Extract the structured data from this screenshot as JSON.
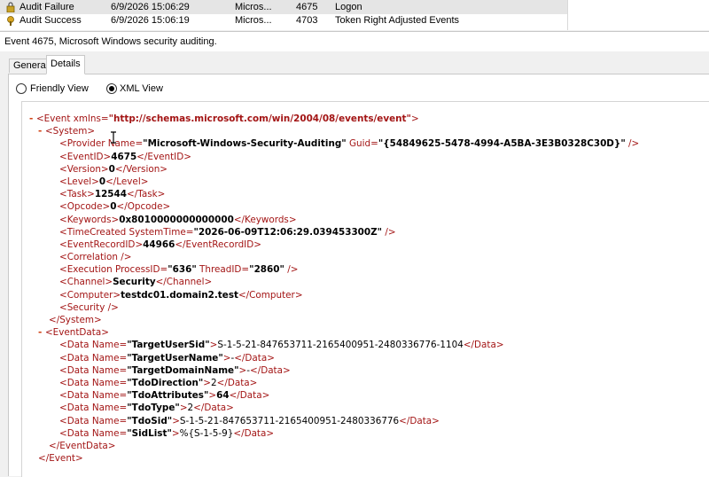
{
  "event_list": {
    "rows": [
      {
        "keywords": "Audit Failure",
        "date": "6/9/2026 15:06:29",
        "source": "Micros...",
        "id": "4675",
        "task": "Logon"
      },
      {
        "keywords": "Audit Success",
        "date": "6/9/2026 15:06:19",
        "source": "Micros...",
        "id": "4703",
        "task": "Token Right Adjusted Events"
      }
    ]
  },
  "detail": {
    "header": "Event 4675, Microsoft Windows security auditing."
  },
  "tabs": {
    "general": "General",
    "details": "Details"
  },
  "view": {
    "friendly": "Friendly View",
    "xml": "XML View",
    "selected": "XML View"
  },
  "xml": {
    "event_ns": "http://schemas.microsoft.com/win/2004/08/events/event",
    "provider_name": "Microsoft-Windows-Security-Auditing",
    "provider_guid": "{54849625-5478-4994-A5BA-3E3B0328C30D}",
    "event_id": "4675",
    "version": "0",
    "level": "0",
    "task": "12544",
    "opcode": "0",
    "keywords": "0x8010000000000000",
    "system_time": "2026-06-09T12:06:29.039453300Z",
    "record_id": "44966",
    "process_id": "636",
    "thread_id": "2860",
    "channel": "Security",
    "computer": "testdc01.domain2.test",
    "data": [
      {
        "name": "TargetUserSid",
        "value": "S-1-5-21-847653711-2165400951-2480336776-1104"
      },
      {
        "name": "TargetUserName",
        "value": "-"
      },
      {
        "name": "TargetDomainName",
        "value": "-"
      },
      {
        "name": "TdoDirection",
        "value": "2"
      },
      {
        "name": "TdoAttributes",
        "value": "64"
      },
      {
        "name": "TdoType",
        "value": "2"
      },
      {
        "name": "TdoSid",
        "value": "S-1-5-21-847653711-2165400951-2480336776"
      },
      {
        "name": "SidList",
        "value": "%{S-1-5-9}"
      }
    ]
  }
}
